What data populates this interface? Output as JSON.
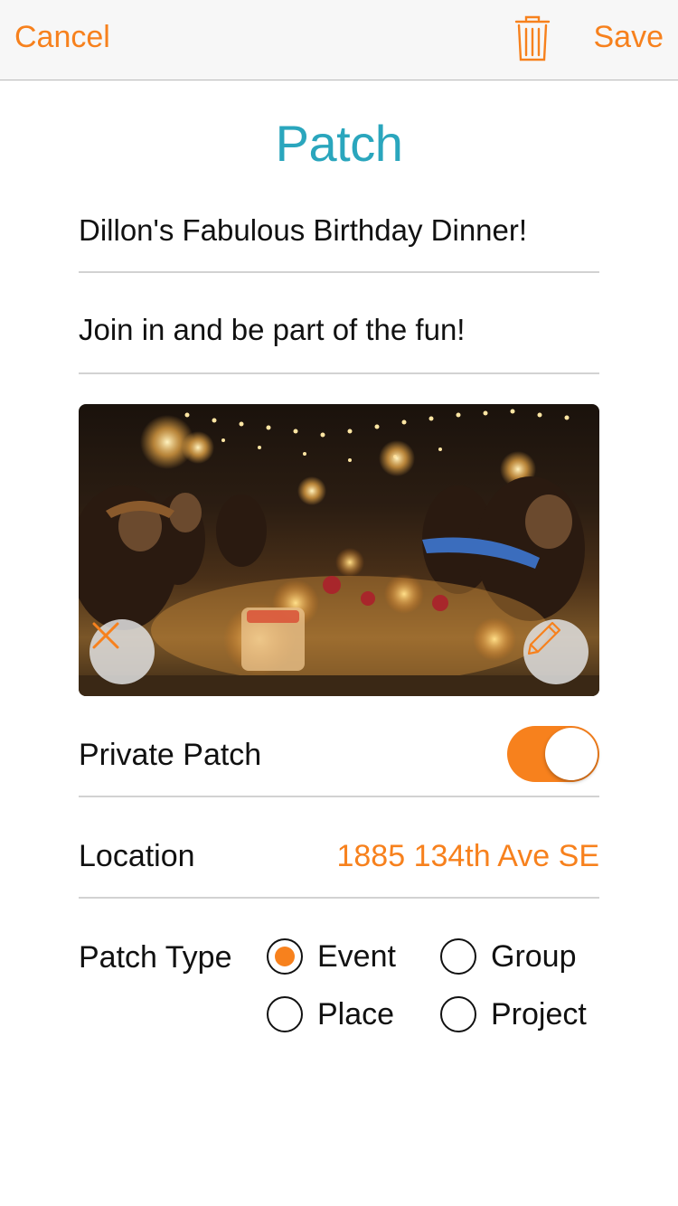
{
  "navbar": {
    "cancel_label": "Cancel",
    "save_label": "Save",
    "trash_icon": "trash-icon"
  },
  "page_title": "Patch",
  "form": {
    "name_value": "Dillon's Fabulous Birthday Dinner!",
    "description_value": "Join in and be part of the fun!",
    "photo": {
      "remove_icon": "close-icon",
      "edit_icon": "pencil-icon"
    },
    "private": {
      "label": "Private Patch",
      "on": true
    },
    "location": {
      "label": "Location",
      "value": "1885 134th Ave SE"
    },
    "patch_type": {
      "label": "Patch Type",
      "options": [
        "Event",
        "Group",
        "Place",
        "Project"
      ],
      "selected": "Event"
    }
  },
  "colors": {
    "accent": "#f7811d",
    "title": "#2aa6bd"
  }
}
